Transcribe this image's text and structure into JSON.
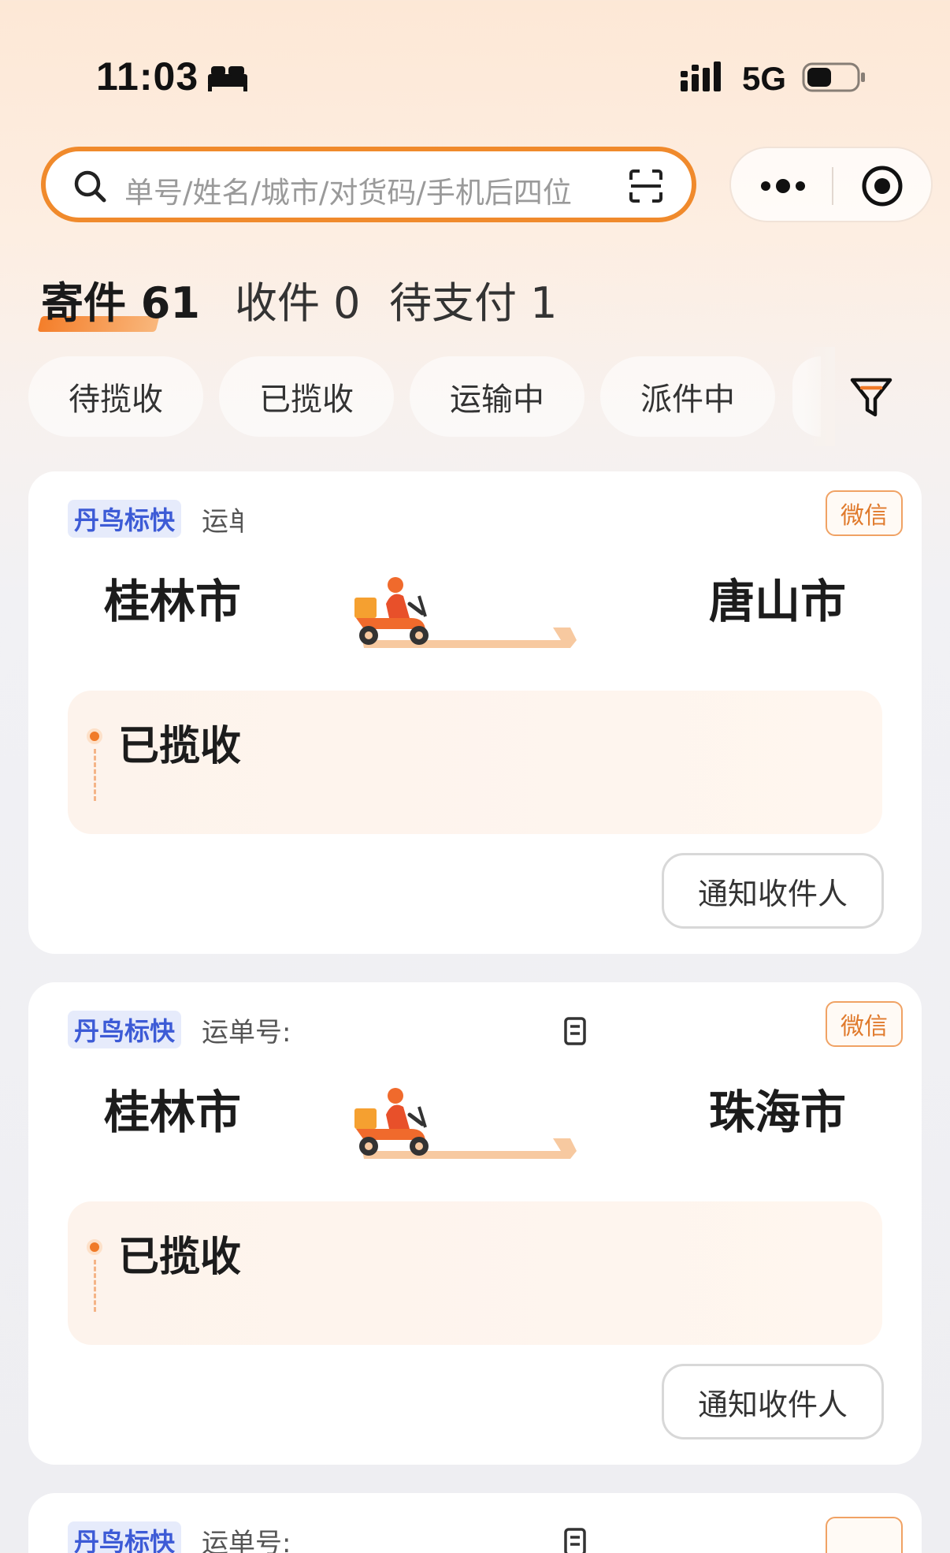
{
  "status_bar": {
    "time": "11:03",
    "network": "5G",
    "icons": [
      "bed-icon",
      "signal-icon",
      "battery-icon"
    ]
  },
  "search": {
    "placeholder": "单号/姓名/城市/对货码/手机后四位",
    "icons": [
      "search-icon",
      "scan-icon"
    ]
  },
  "capsule": {
    "icons": [
      "more-icon",
      "target-icon"
    ]
  },
  "tabs": [
    {
      "label": "寄件 61",
      "active": true
    },
    {
      "label": "收件 0",
      "active": false
    },
    {
      "label": "待支付 1",
      "active": false
    }
  ],
  "filters": [
    "待揽收",
    "已揽收",
    "运输中",
    "派件中"
  ],
  "filter_icon": "filter-icon",
  "colors": {
    "accent": "#f08a2c",
    "badge_bg": "#e6ebfb",
    "badge_text": "#3d5bd6",
    "status_dot": "#f07a28"
  },
  "shipments": [
    {
      "carrier": "丹鸟标快",
      "waybill_label": "运单号",
      "tag": "微信",
      "from_city": "桂林市",
      "to_city": "唐山市",
      "status": "已揽收",
      "action": "通知收件人"
    },
    {
      "carrier": "丹鸟标快",
      "waybill_label": "运单号:",
      "tag": "微信",
      "from_city": "桂林市",
      "to_city": "珠海市",
      "status": "已揽收",
      "action": "通知收件人"
    },
    {
      "carrier": "丹鸟标快",
      "waybill_label": "运单号:"
    }
  ]
}
